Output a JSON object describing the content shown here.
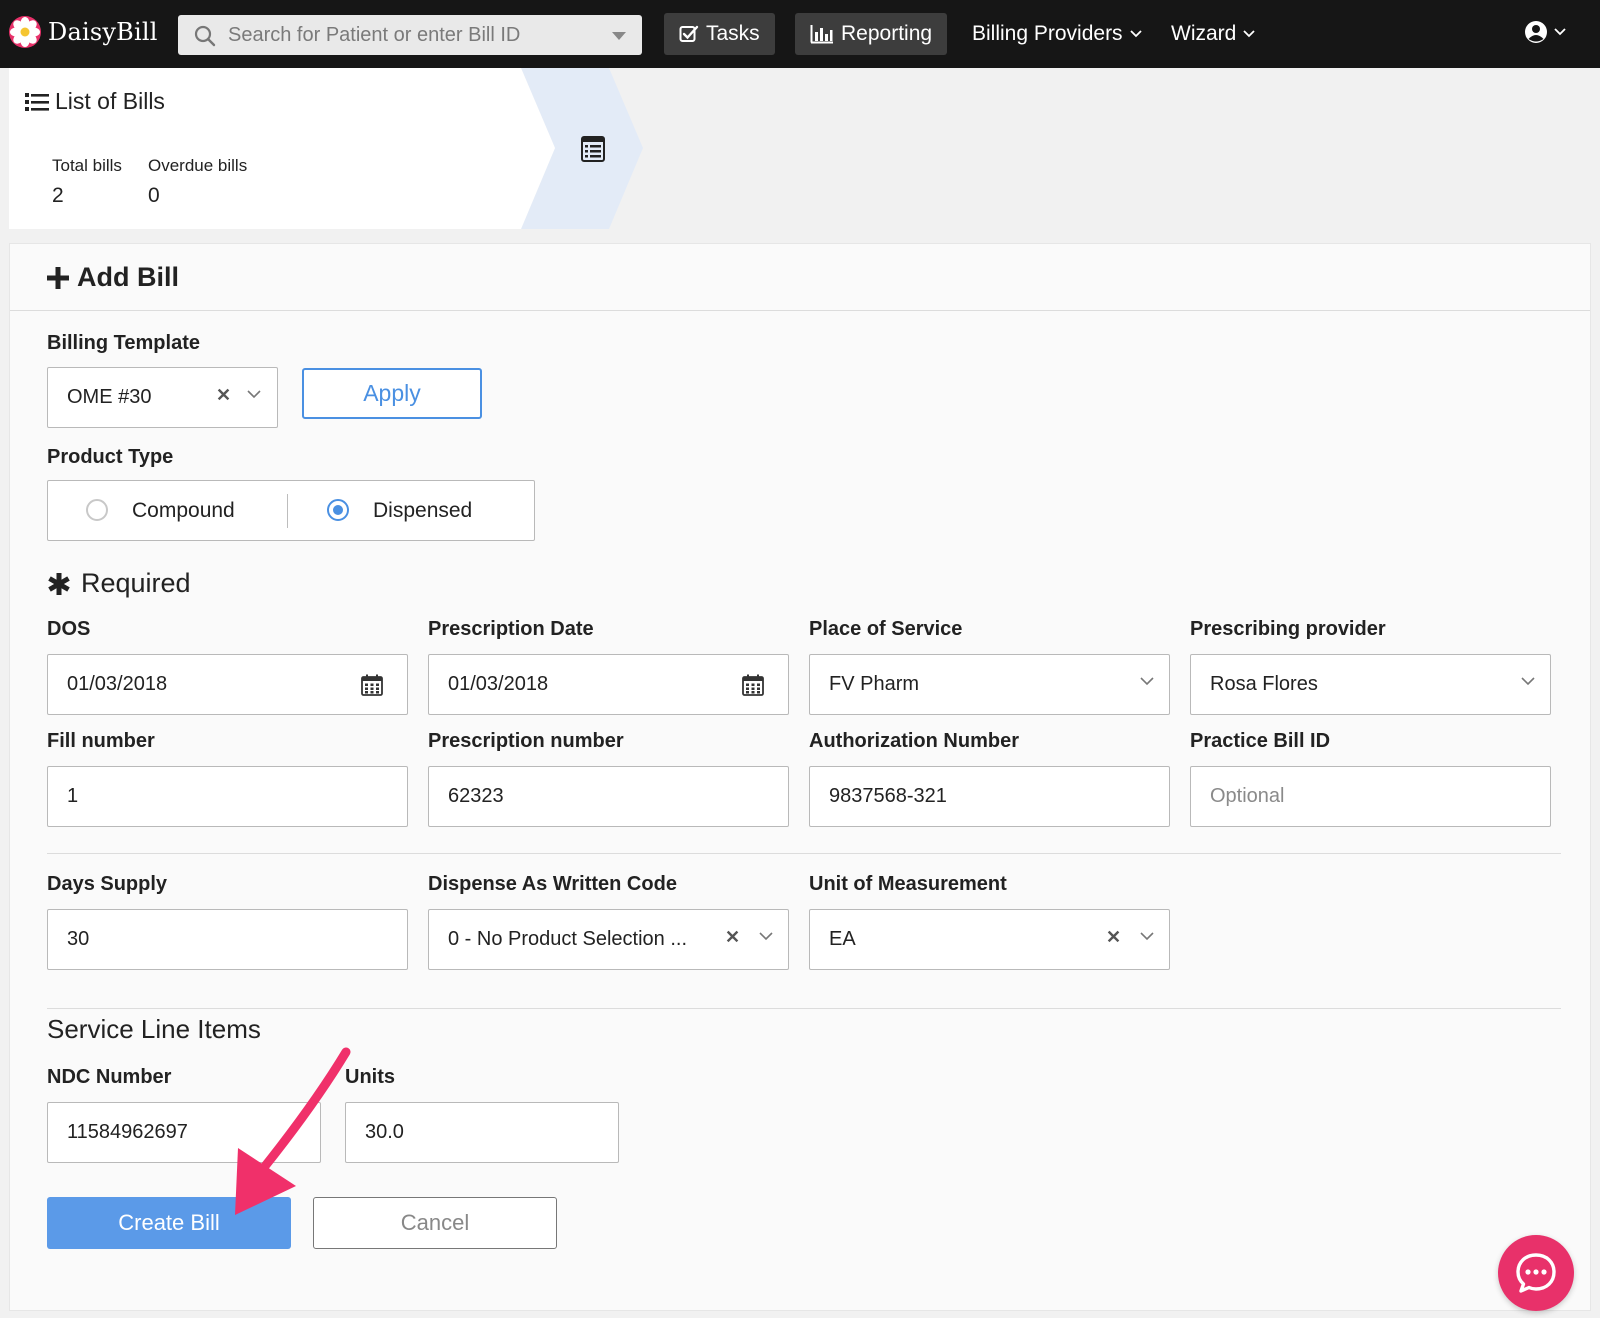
{
  "brand": {
    "name": "DaisyBill"
  },
  "nav": {
    "search_placeholder": "Search for Patient or enter Bill ID",
    "tasks_label": "Tasks",
    "reporting_label": "Reporting",
    "billing_providers_label": "Billing Providers",
    "wizard_label": "Wizard"
  },
  "list_of_bills": {
    "title": "List of Bills",
    "total_label": "Total bills",
    "total_value": "2",
    "overdue_label": "Overdue bills",
    "overdue_value": "0"
  },
  "add_bill": {
    "title": "Add Bill",
    "billing_template": {
      "label": "Billing Template",
      "value": "OME #30",
      "apply_label": "Apply"
    },
    "product_type": {
      "label": "Product Type",
      "options": [
        {
          "label": "Compound",
          "selected": false
        },
        {
          "label": "Dispensed",
          "selected": true
        }
      ]
    },
    "required_title": "Required",
    "fields": {
      "dos": {
        "label": "DOS",
        "value": "01/03/2018"
      },
      "prescription_date": {
        "label": "Prescription Date",
        "value": "01/03/2018"
      },
      "place_of_service": {
        "label": "Place of Service",
        "value": "FV Pharm"
      },
      "prescribing_provider": {
        "label": "Prescribing provider",
        "value": "Rosa Flores"
      },
      "fill_number": {
        "label": "Fill number",
        "value": "1"
      },
      "prescription_number": {
        "label": "Prescription number",
        "value": "62323"
      },
      "authorization_number": {
        "label": "Authorization Number",
        "value": "9837568-321"
      },
      "practice_bill_id": {
        "label": "Practice Bill ID",
        "value": "",
        "placeholder": "Optional"
      },
      "days_supply": {
        "label": "Days Supply",
        "value": "30"
      },
      "daw_code": {
        "label": "Dispense As Written Code",
        "value": "0 - No Product Selection ..."
      },
      "unit_of_measurement": {
        "label": "Unit of Measurement",
        "value": "EA"
      }
    },
    "service_line_items": {
      "title": "Service Line Items",
      "ndc_label": "NDC Number",
      "ndc_value": "11584962697",
      "units_label": "Units",
      "units_value": "30.0"
    },
    "create_label": "Create Bill",
    "cancel_label": "Cancel"
  },
  "colors": {
    "accent": "#4a90e2",
    "primary_button": "#5b9ae8",
    "arrow": "#f0306a",
    "chat": "#e8316a",
    "nav_bg": "#161616"
  }
}
